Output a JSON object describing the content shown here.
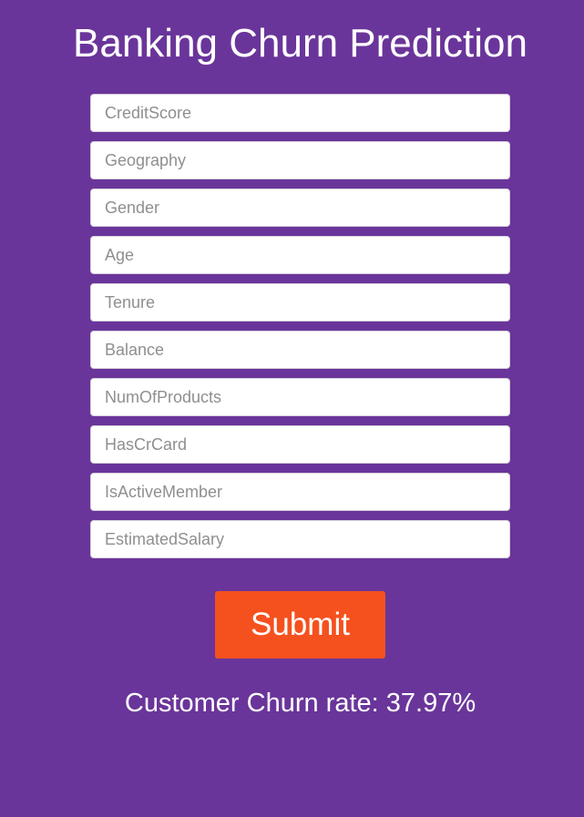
{
  "header": {
    "title": "Banking Churn Prediction"
  },
  "form": {
    "fields": [
      {
        "placeholder": "CreditScore",
        "value": ""
      },
      {
        "placeholder": "Geography",
        "value": ""
      },
      {
        "placeholder": "Gender",
        "value": ""
      },
      {
        "placeholder": "Age",
        "value": ""
      },
      {
        "placeholder": "Tenure",
        "value": ""
      },
      {
        "placeholder": "Balance",
        "value": ""
      },
      {
        "placeholder": "NumOfProducts",
        "value": ""
      },
      {
        "placeholder": "HasCrCard",
        "value": ""
      },
      {
        "placeholder": "IsActiveMember",
        "value": ""
      },
      {
        "placeholder": "EstimatedSalary",
        "value": ""
      }
    ],
    "submit_label": "Submit"
  },
  "result": {
    "text": "Customer Churn rate: 37.97%"
  },
  "colors": {
    "background": "#6a359a",
    "submit_button": "#f5511e",
    "text": "#ffffff"
  }
}
